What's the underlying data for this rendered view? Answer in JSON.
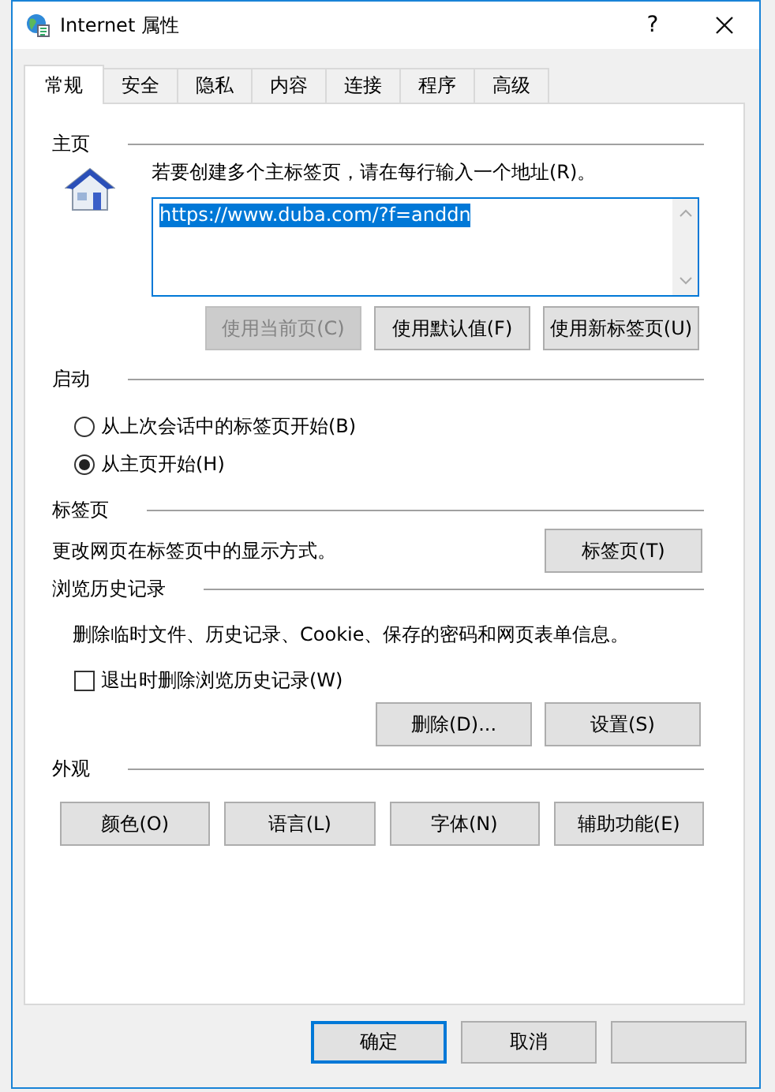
{
  "window": {
    "title": "Internet 属性",
    "help": "?"
  },
  "tabs": [
    {
      "label": "常规",
      "selected": true
    },
    {
      "label": "安全",
      "selected": false
    },
    {
      "label": "隐私",
      "selected": false
    },
    {
      "label": "内容",
      "selected": false
    },
    {
      "label": "连接",
      "selected": false
    },
    {
      "label": "程序",
      "selected": false
    },
    {
      "label": "高级",
      "selected": false
    }
  ],
  "home": {
    "heading": "主页",
    "instruction": "若要创建多个主标签页，请在每行输入一个地址(R)。",
    "urls": {
      "value": "https://www.duba.com/?f=anddn",
      "selected": true
    },
    "buttons": [
      {
        "label": "使用当前页(C)",
        "disabled": true
      },
      {
        "label": "使用默认值(F)",
        "disabled": false
      },
      {
        "label": "使用新标签页(U)",
        "disabled": false
      }
    ]
  },
  "startup": {
    "heading": "启动",
    "options": [
      {
        "label": "从上次会话中的标签页开始(B)",
        "selected": false
      },
      {
        "label": "从主页开始(H)",
        "selected": true
      }
    ]
  },
  "tabs_section": {
    "heading": "标签页",
    "description": "更改网页在标签页中的显示方式。",
    "button": "标签页(T)"
  },
  "history": {
    "heading": "浏览历史记录",
    "description": "删除临时文件、历史记录、Cookie、保存的密码和网页表单信息。",
    "checkbox": {
      "label": "退出时删除浏览历史记录(W)",
      "checked": false
    },
    "buttons": [
      "删除(D)...",
      "设置(S)"
    ]
  },
  "appearance": {
    "heading": "外观",
    "buttons": [
      "颜色(O)",
      "语言(L)",
      "字体(N)",
      "辅助功能(E)"
    ]
  },
  "footer": [
    {
      "label": "确定",
      "default": true
    },
    {
      "label": "取消",
      "default": false
    }
  ]
}
